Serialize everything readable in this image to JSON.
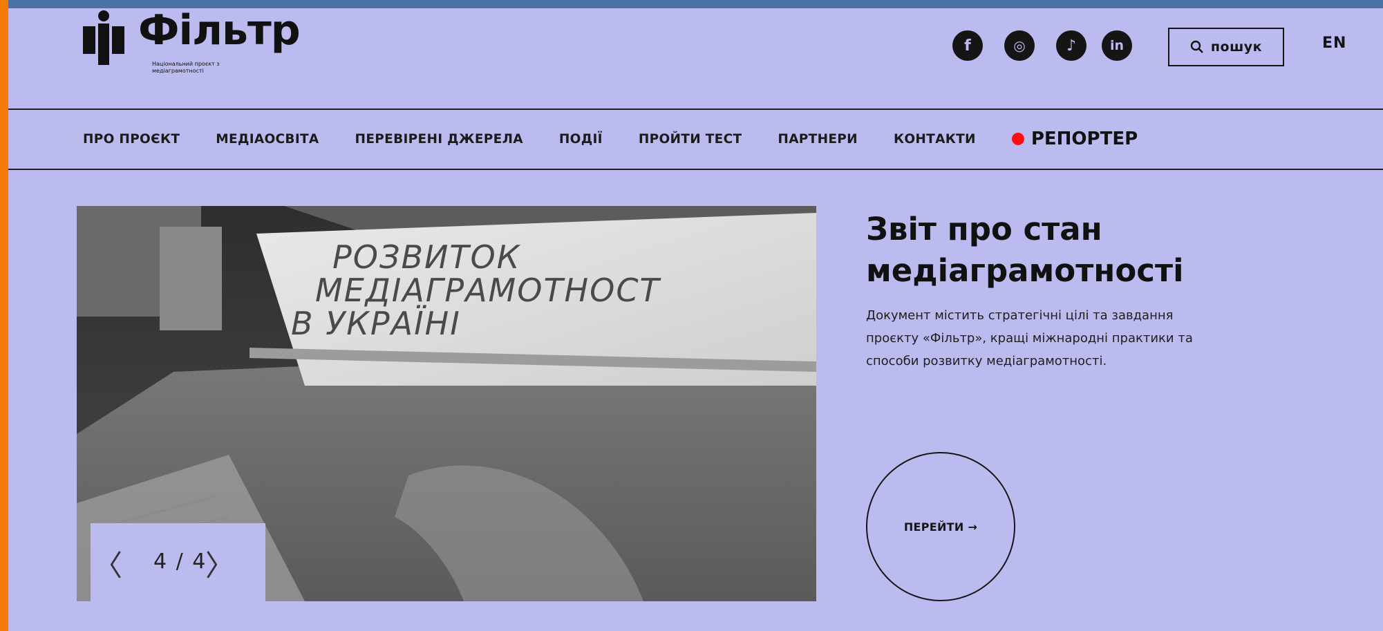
{
  "header": {
    "logo_text": "Фільтр",
    "logo_tagline": "Національний проєкт з медіаграмотності",
    "social": [
      {
        "name": "facebook-icon",
        "glyph": "f"
      },
      {
        "name": "instagram-icon",
        "glyph": "◎"
      },
      {
        "name": "tiktok-icon",
        "glyph": "♪"
      },
      {
        "name": "linkedin-icon",
        "glyph": "in"
      }
    ],
    "search_label": "пошук",
    "lang_label": "EN"
  },
  "nav": {
    "items": [
      "ПРО ПРОЄКТ",
      "МЕДІАОСВІТА",
      "ПЕРЕВІРЕНІ ДЖЕРЕЛА",
      "ПОДІЇ",
      "ПРОЙТИ ТЕСТ",
      "ПАРТНЕРИ",
      "КОНТАКТИ"
    ],
    "reporter": "РЕПОРТЕР"
  },
  "slider": {
    "image_text_lines": [
      "РОЗВИТОК",
      "МЕДІАГРАМОТНОСТ",
      "В УКРАЇНІ"
    ],
    "counter": "4 / 4",
    "prev_glyph": "〈",
    "next_glyph": "〉"
  },
  "feature": {
    "title": "Звіт про стан медіаграмотності",
    "description": "Документ містить стратегічні цілі та завдання проєкту «Фільтр», кращі міжнародні практики та способи розвитку медіаграмотності.",
    "cta_label": "ПЕРЕЙТИ →"
  },
  "colors": {
    "background": "#bbbbef",
    "top_bar": "#4a73a4",
    "left_bar": "#f47a07",
    "reporter_dot": "#ff0f0f",
    "text": "#151515"
  }
}
